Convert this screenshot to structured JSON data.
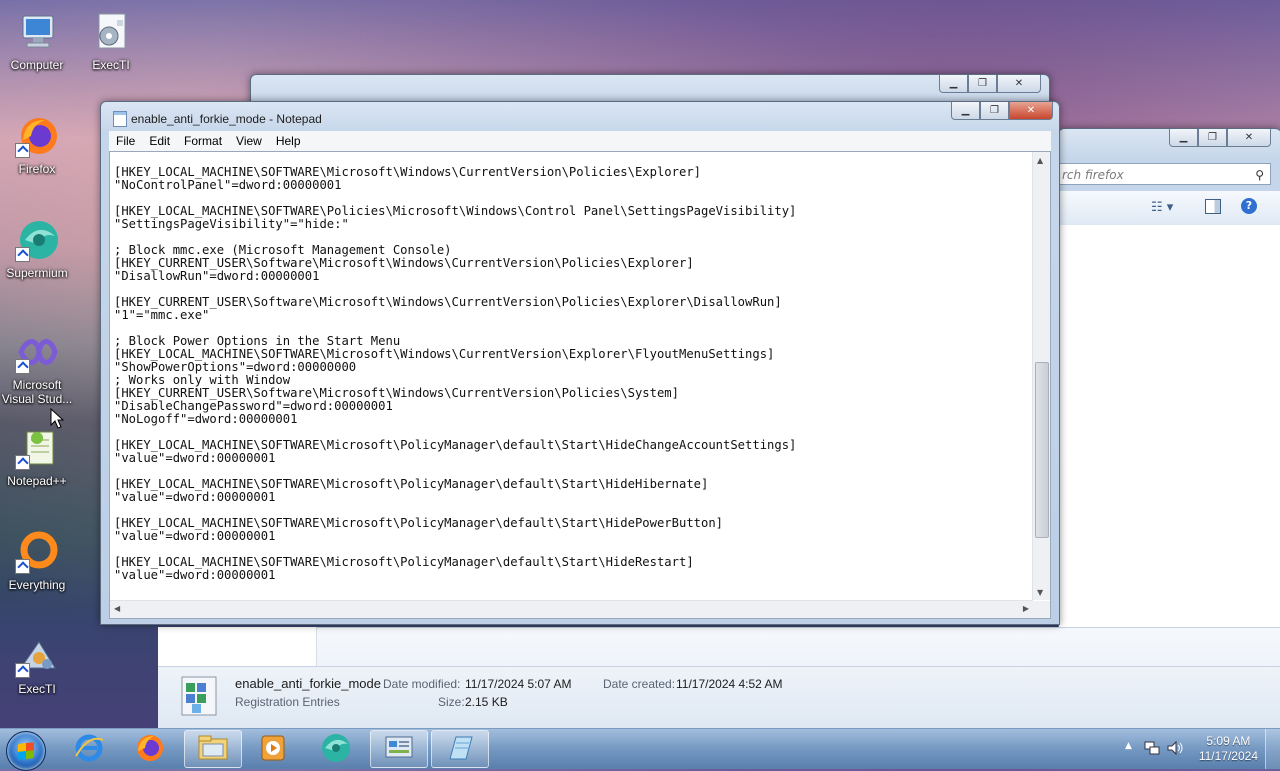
{
  "desktop": {
    "icons": [
      {
        "label": "Computer",
        "icon": "computer-icon"
      },
      {
        "label": "ExecTI",
        "icon": "execti-icon"
      },
      {
        "label": "Firefox",
        "icon": "firefox-icon"
      },
      {
        "label": "Supermium",
        "icon": "supermium-icon"
      },
      {
        "label": "Microsoft Visual Stud...",
        "icon": "visual-studio-icon"
      },
      {
        "label": "Notepad++",
        "icon": "notepad-plus-plus-icon"
      },
      {
        "label": "Everything",
        "icon": "everything-icon"
      },
      {
        "label": "ExecTI",
        "icon": "execti-icon"
      }
    ]
  },
  "explorer": {
    "search_placeholder": "rch firefox",
    "details": {
      "file_name": "enable_anti_forkie_mode",
      "file_type": "Registration Entries",
      "modified_label": "Date modified:",
      "modified_value": "11/17/2024 5:07 AM",
      "created_label": "Date created:",
      "created_value": "11/17/2024 4:52 AM",
      "size_label": "Size:",
      "size_value": "2.15 KB"
    }
  },
  "notepad": {
    "title": "enable_anti_forkie_mode - Notepad",
    "menu": [
      "File",
      "Edit",
      "Format",
      "View",
      "Help"
    ],
    "content": "[HKEY_LOCAL_MACHINE\\SOFTWARE\\Microsoft\\Windows\\CurrentVersion\\Policies\\Explorer]\n\"NoControlPanel\"=dword:00000001\n\n[HKEY_LOCAL_MACHINE\\SOFTWARE\\Policies\\Microsoft\\Windows\\Control Panel\\SettingsPageVisibility]\n\"SettingsPageVisibility\"=\"hide:\"\n\n; Block mmc.exe (Microsoft Management Console)\n[HKEY_CURRENT_USER\\Software\\Microsoft\\Windows\\CurrentVersion\\Policies\\Explorer]\n\"DisallowRun\"=dword:00000001\n\n[HKEY_CURRENT_USER\\Software\\Microsoft\\Windows\\CurrentVersion\\Policies\\Explorer\\DisallowRun]\n\"1\"=\"mmc.exe\"\n\n; Block Power Options in the Start Menu\n[HKEY_LOCAL_MACHINE\\SOFTWARE\\Microsoft\\Windows\\CurrentVersion\\Explorer\\FlyoutMenuSettings]\n\"ShowPowerOptions\"=dword:00000000\n; Works only with Window\n[HKEY_CURRENT_USER\\Software\\Microsoft\\Windows\\CurrentVersion\\Policies\\System]\n\"DisableChangePassword\"=dword:00000001\n\"NoLogoff\"=dword:00000001\n\n[HKEY_LOCAL_MACHINE\\SOFTWARE\\Microsoft\\PolicyManager\\default\\Start\\HideChangeAccountSettings]\n\"value\"=dword:00000001\n\n[HKEY_LOCAL_MACHINE\\SOFTWARE\\Microsoft\\PolicyManager\\default\\Start\\HideHibernate]\n\"value\"=dword:00000001\n\n[HKEY_LOCAL_MACHINE\\SOFTWARE\\Microsoft\\PolicyManager\\default\\Start\\HidePowerButton]\n\"value\"=dword:00000001\n\n[HKEY_LOCAL_MACHINE\\SOFTWARE\\Microsoft\\PolicyManager\\default\\Start\\HideRestart]\n\"value\"=dword:00000001"
  },
  "taskbar": {
    "items": [
      "internet-explorer-icon",
      "firefox-icon",
      "file-explorer-icon",
      "media-player-icon",
      "supermium-icon",
      "control-panel-icon",
      "notepad-icon"
    ],
    "clock_time": "5:09 AM",
    "clock_date": "11/17/2024"
  },
  "colors": {
    "accent": "#2a6fc4",
    "close_button": "#c8452d"
  }
}
